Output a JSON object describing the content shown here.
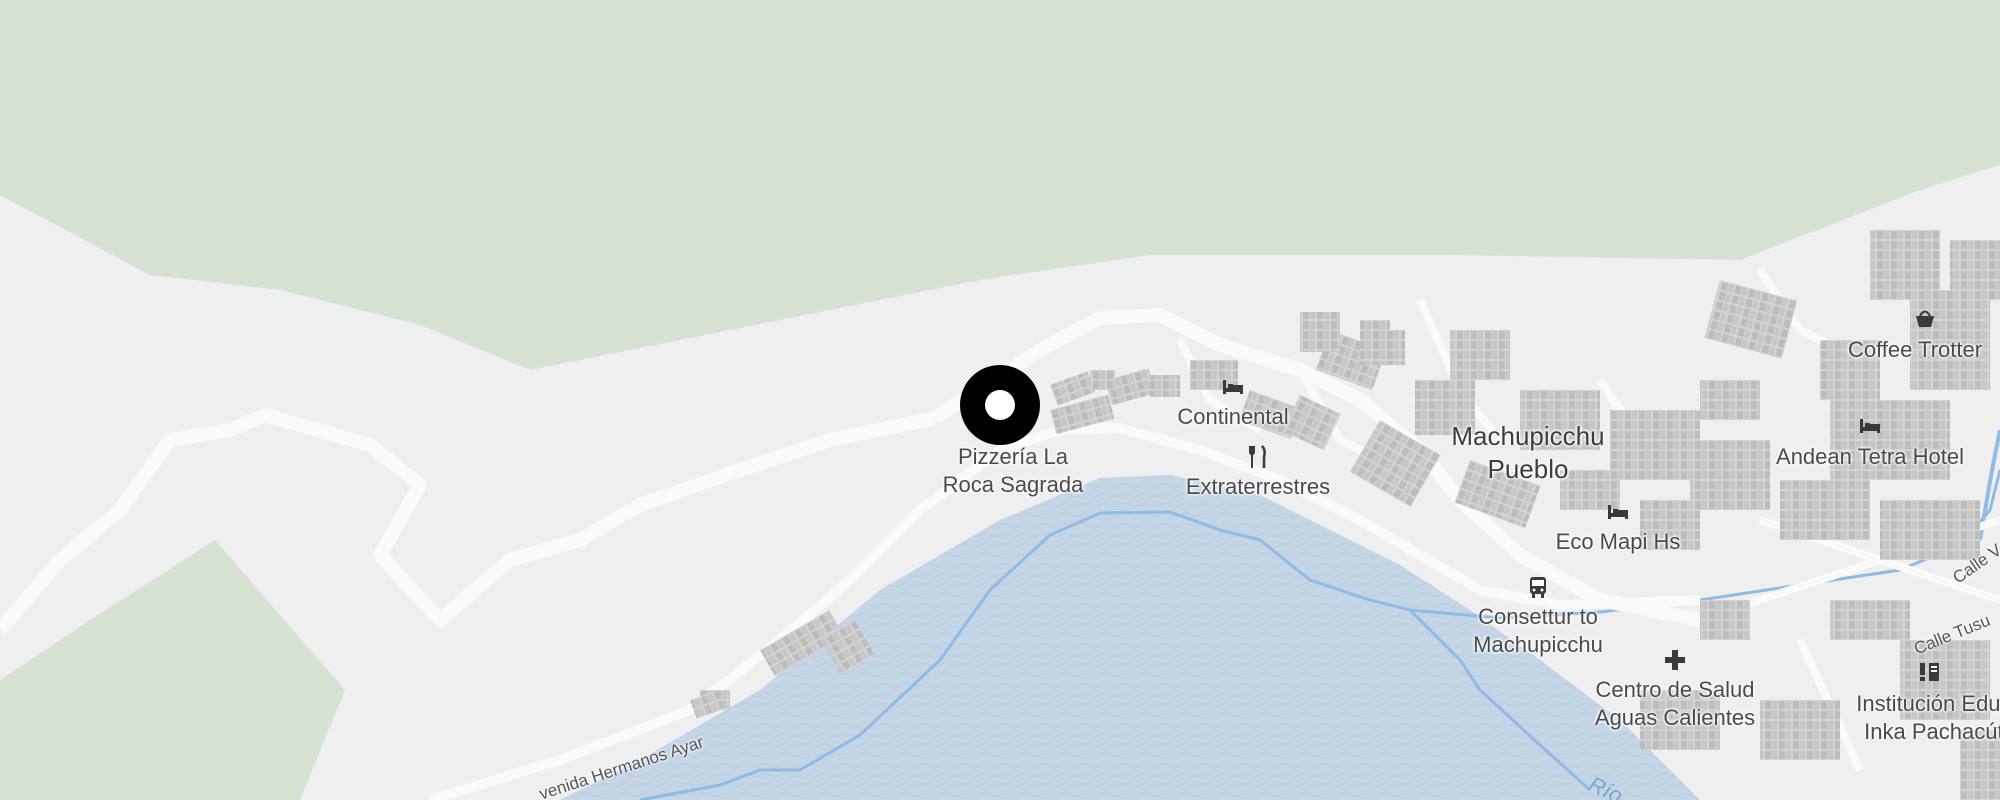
{
  "map": {
    "places": [
      {
        "id": "machupicchu-pueblo",
        "lines": [
          "Machupicchu",
          "Pueblo"
        ]
      }
    ],
    "pois": [
      {
        "id": "pizzeria",
        "lines": [
          "Pizzería La",
          "Roca Sagrada"
        ],
        "icon": "target-pin-icon"
      },
      {
        "id": "continental",
        "lines": [
          "Continental"
        ],
        "icon": "bed-icon"
      },
      {
        "id": "extraterrestres",
        "lines": [
          "Extraterrestres"
        ],
        "icon": "fork-knife-icon"
      },
      {
        "id": "coffee-trotters",
        "lines": [
          "Coffee Trotter"
        ],
        "icon": "basket-icon"
      },
      {
        "id": "andean-tetra",
        "lines": [
          "Andean Tetra Hotel"
        ],
        "icon": "bed-icon"
      },
      {
        "id": "eco-mapi",
        "lines": [
          "Eco Mapi Hs"
        ],
        "icon": "bed-icon"
      },
      {
        "id": "consettur",
        "lines": [
          "Consettur to",
          "Machupicchu"
        ],
        "icon": "bus-icon"
      },
      {
        "id": "centro-salud",
        "lines": [
          "Centro de Salud",
          "Aguas Calientes"
        ],
        "icon": "medical-cross-icon"
      },
      {
        "id": "institucion",
        "lines": [
          "Institución Educa",
          "Inka Pachacúte"
        ],
        "icon": "school-icon"
      }
    ],
    "roads": {
      "avenida": "venida Hermanos Ayar",
      "calle_tusu": "Calle Tusu",
      "calle_v": "Calle V"
    },
    "river": "Río",
    "colors": {
      "forest": "#d6e3d3",
      "land": "#efefef",
      "water": "#c4d6e6",
      "water_line": "#8fbbe6",
      "building": "#c9c9c9",
      "road": "#fafafa",
      "pin": "#000000"
    }
  }
}
